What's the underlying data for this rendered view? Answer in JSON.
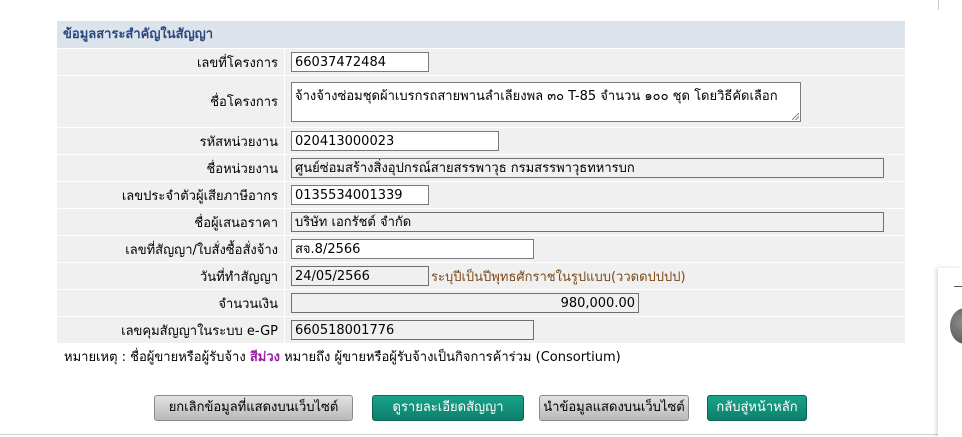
{
  "panel": {
    "title": "ข้อมูลสาระสำคัญในสัญญา",
    "fields": {
      "project_no": {
        "label": "เลขที่โครงการ",
        "value": "66037472484"
      },
      "project_name": {
        "label": "ชื่อโครงการ",
        "value": "จ้างจ้างซ่อมชุดผ้าเบรกรถสายพานลำเลียงพล ๓๐ T-85 จำนวน ๑๐๐ ชุด โดยวิธีคัดเลือก"
      },
      "agency_code": {
        "label": "รหัสหน่วยงาน",
        "value": "020413000023"
      },
      "agency_name": {
        "label": "ชื่อหน่วยงาน",
        "value": "ศูนย์ซ่อมสร้างสิ่งอุปกรณ์สายสรรพาวุธ กรมสรรพาวุธทหารบก"
      },
      "tax_id": {
        "label": "เลขประจำตัวผู้เสียภาษีอากร",
        "value": "0135534001339"
      },
      "bidder_name": {
        "label": "ชื่อผู้เสนอราคา",
        "value": "บริษัท เอกรัชต์ จำกัด"
      },
      "contract_no": {
        "label": "เลขที่สัญญา/ใบสั่งซื้อสั่งจ้าง",
        "value": "สจ.8/2566"
      },
      "contract_date": {
        "label": "วันที่ทำสัญญา",
        "value": "24/05/2566",
        "note": "ระบุปีเป็นปีพุทธศักราชในรูปแบบ(ววดดปปปป)"
      },
      "amount": {
        "label": "จำนวนเงิน",
        "value": "980,000.00"
      },
      "egp_no": {
        "label": "เลขคุมสัญญาในระบบ e-GP",
        "value": "660518001776"
      }
    }
  },
  "note": {
    "prefix": "หมายเหตุ : ชื่อผู้ขายหรือผู้รับจ้าง ",
    "highlight": "สีม่วง",
    "suffix": " หมายถึง ผู้ขายหรือผู้รับจ้างเป็นกิจการค้าร่วม (Consortium)",
    "highlight_color": "#9b1fa3"
  },
  "buttons": {
    "cancel": "ยกเลิกข้อมูลที่แสดงบนเว็บไซต์",
    "details": "ดูรายละเอียดสัญญา",
    "publish": "นำข้อมูลแสดงบนเว็บไซต์",
    "home": "กลับสู่หน้าหลัก"
  }
}
